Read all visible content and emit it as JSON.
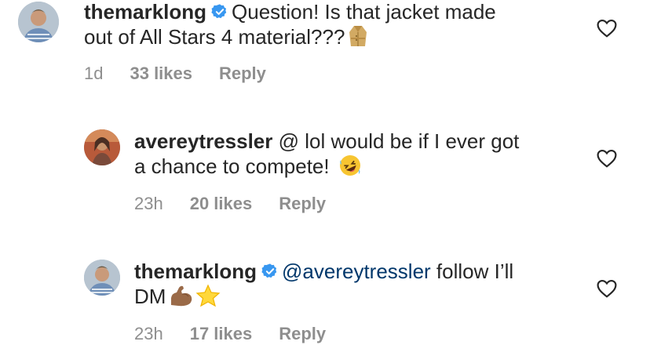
{
  "comments": [
    {
      "username": "themarklong",
      "verified": true,
      "line1": "Question! Is that jacket made",
      "line2": "out of All Stars 4 material???",
      "emoji": "coat-emoji",
      "time": "1d",
      "likes": "33 likes",
      "reply": "Reply"
    },
    {
      "username": "avereytressler",
      "verified": false,
      "mention": "@",
      "line1": " lol would be if I ever got",
      "line2": "a chance to compete!",
      "emoji": "rolling-laughing-emoji",
      "time": "23h",
      "likes": "20 likes",
      "reply": "Reply"
    },
    {
      "username": "themarklong",
      "verified": true,
      "mention": "@avereytressler",
      "line1": " follow I’ll",
      "line2": "DM",
      "emoji": "flexed-biceps-and-star-emoji",
      "time": "23h",
      "likes": "17 likes",
      "reply": "Reply"
    }
  ],
  "colors": {
    "text": "#262626",
    "meta": "#8e8e8e",
    "mention": "#00376b",
    "verified": "#3897f0"
  }
}
